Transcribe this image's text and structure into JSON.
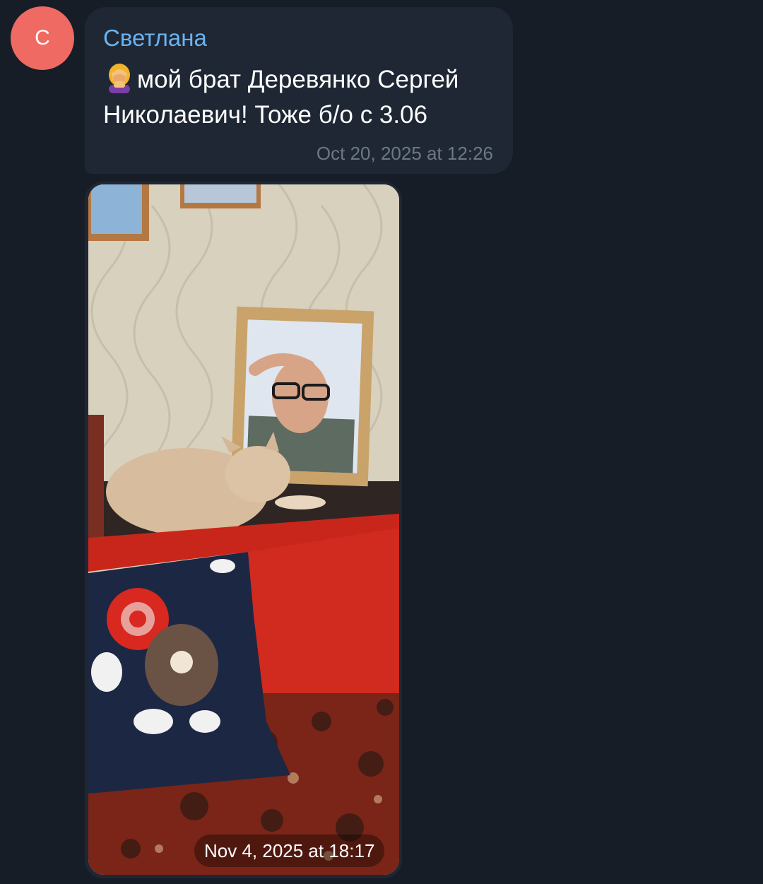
{
  "avatar": {
    "letter": "С",
    "color": "#ef6a62"
  },
  "message": {
    "sender": "Светлана",
    "emoji": "facepalm-woman",
    "text": "мой брат Деревянко Сергей Николаевич! Тоже б/о с 3.06",
    "time": "Oct 20, 2025 at 12:26"
  },
  "photo_message": {
    "time": "Nov 4, 2025 at 18:17"
  },
  "colors": {
    "background": "#161d27",
    "bubble": "#1e2733",
    "sender_name": "#6ab3f3",
    "meta_text": "#6d7885"
  }
}
